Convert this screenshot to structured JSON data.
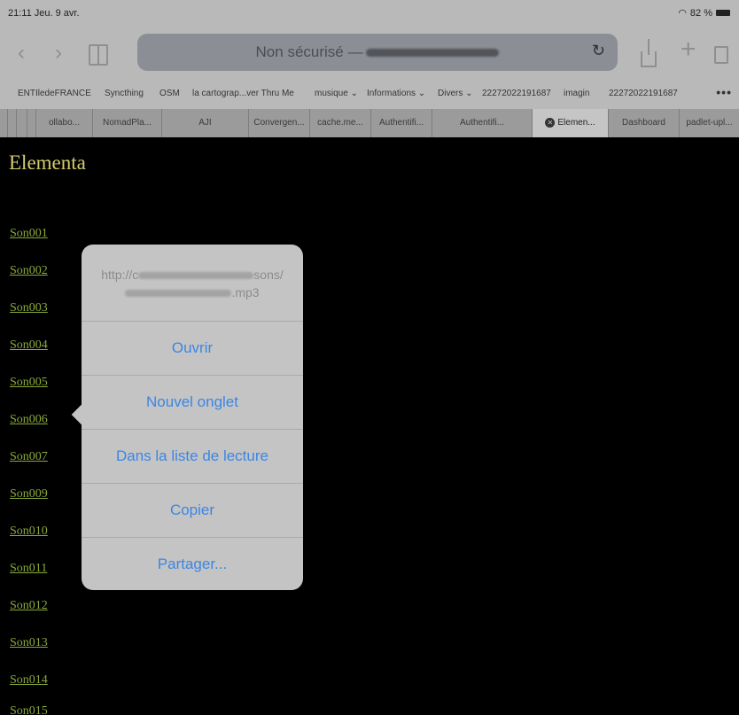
{
  "status": {
    "time": "21:11 Jeu. 9 avr.",
    "battery": "82 %"
  },
  "toolbar": {
    "address": "Non sécurisé —",
    "icons": [
      "back-icon",
      "forward-icon",
      "bookmarks-icon",
      "reload-icon",
      "share-icon",
      "add-icon",
      "tabs-icon"
    ]
  },
  "favorites": [
    "ENTIledeFRANCE",
    "Syncthing",
    "OSM",
    "la cartograp...ver Thru Me",
    "musique ⌄",
    "Informations ⌄",
    "Divers ⌄",
    "22272022191687",
    "imagin",
    "22272022191687"
  ],
  "tabs": [
    {
      "label": "ollabo..."
    },
    {
      "label": "NomadPla..."
    },
    {
      "label": "AJI"
    },
    {
      "label": "Convergen..."
    },
    {
      "label": "cache.me..."
    },
    {
      "label": "Authentifi..."
    },
    {
      "label": "Authentifi..."
    },
    {
      "label": "Elemen...",
      "active": true
    },
    {
      "label": "Dashboard"
    },
    {
      "label": "padlet-upl..."
    }
  ],
  "page": {
    "title": "Elementa",
    "links": [
      "Son001",
      "Son002",
      "Son003",
      "Son004",
      "Son005",
      "Son006",
      "Son007",
      "Son009",
      "Son010",
      "Son011",
      "Son012",
      "Son013",
      "Son014",
      "Son015"
    ]
  },
  "popover": {
    "url_line1_start": "http://c",
    "url_line1_end": "sons/",
    "url_line2_end": ".mp3",
    "items": [
      "Ouvrir",
      "Nouvel onglet",
      "Dans la liste de lecture",
      "Copier",
      "Partager..."
    ]
  },
  "colors": {
    "link": "#8aa83a",
    "title": "#d4cf6b",
    "action": "#3c86e3"
  }
}
